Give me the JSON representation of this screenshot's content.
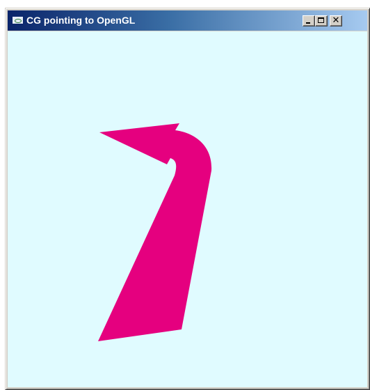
{
  "window": {
    "title": "CG pointing to OpenGL",
    "app_icon": "opengl-app-icon",
    "controls": {
      "minimize_icon": "minimize-icon",
      "maximize_icon": "maximize-icon",
      "close_icon": "close-icon",
      "close_glyph": "✕"
    }
  },
  "canvas": {
    "background_color": "#e0fbff",
    "shape": "arrow",
    "shape_color": "#e5007f"
  }
}
